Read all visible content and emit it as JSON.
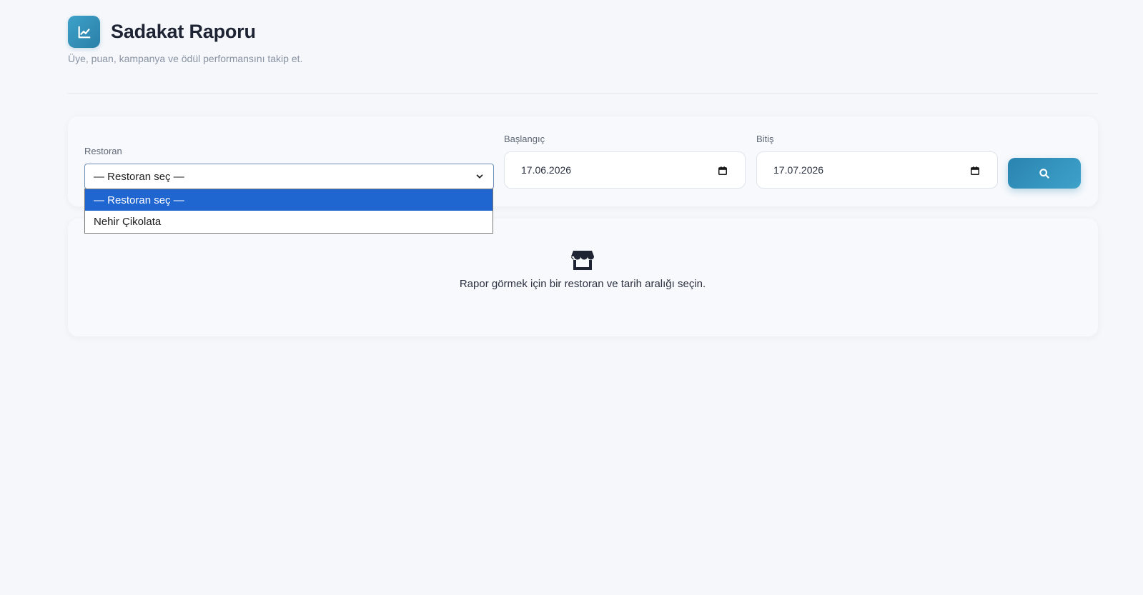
{
  "header": {
    "title": "Sadakat Raporu",
    "subtitle": "Üye, puan, kampanya ve ödül performansını takip et.",
    "icon": "chart-line-icon"
  },
  "filters": {
    "restaurant": {
      "label": "Restoran",
      "selected": "— Restoran seç —",
      "options": [
        "— Restoran seç —",
        "Nehir Çikolata"
      ],
      "open": true
    },
    "start_date": {
      "label": "Başlangıç",
      "value": "17.06.2026"
    },
    "end_date": {
      "label": "Bitiş",
      "value": "17.07.2026"
    },
    "search_button": {
      "icon": "search-icon"
    }
  },
  "empty_state": {
    "icon": "store-icon",
    "message": "Rapor görmek için bir restoran ve tarih aralığı seçin."
  },
  "colors": {
    "accent": "#2a84b0",
    "dropdown_highlight": "#1f66d1",
    "background": "#f5f7fb"
  }
}
